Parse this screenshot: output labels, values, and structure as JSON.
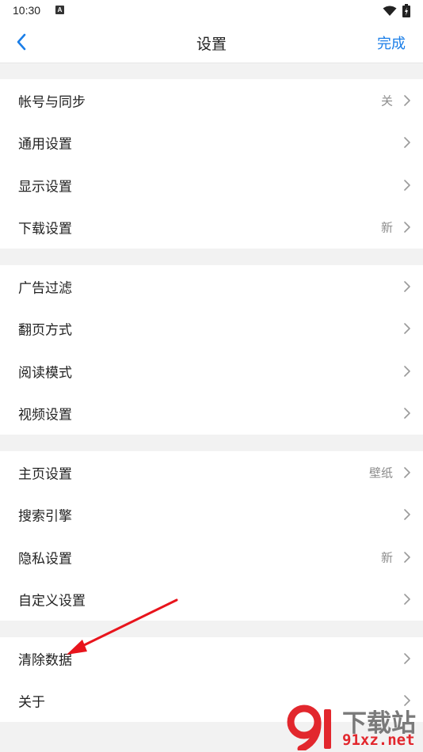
{
  "status_bar": {
    "time": "10:30",
    "notification_icon": "a-box-icon",
    "wifi_icon": "wifi-icon",
    "battery_icon": "battery-icon"
  },
  "nav": {
    "back_icon": "chevron-left-icon",
    "title": "设置",
    "done_label": "完成"
  },
  "groups": [
    {
      "items": [
        {
          "label": "帐号与同步",
          "value": "关"
        },
        {
          "label": "通用设置",
          "value": ""
        },
        {
          "label": "显示设置",
          "value": ""
        },
        {
          "label": "下载设置",
          "value": "新"
        }
      ]
    },
    {
      "items": [
        {
          "label": "广告过滤",
          "value": ""
        },
        {
          "label": "翻页方式",
          "value": ""
        },
        {
          "label": "阅读模式",
          "value": ""
        },
        {
          "label": "视频设置",
          "value": ""
        }
      ]
    },
    {
      "items": [
        {
          "label": "主页设置",
          "value": "壁纸"
        },
        {
          "label": "搜索引擎",
          "value": ""
        },
        {
          "label": "隐私设置",
          "value": "新"
        },
        {
          "label": "自定义设置",
          "value": ""
        }
      ]
    },
    {
      "items": [
        {
          "label": "清除数据",
          "value": ""
        },
        {
          "label": "关于",
          "value": ""
        }
      ]
    }
  ],
  "annotation": {
    "arrow_color": "#e8141c"
  },
  "watermark": {
    "title": "下载站",
    "url": "91xz.net"
  },
  "colors": {
    "accent": "#1a7ee8",
    "divider_bg": "#f2f2f2",
    "secondary_text": "#8c8c8c"
  }
}
